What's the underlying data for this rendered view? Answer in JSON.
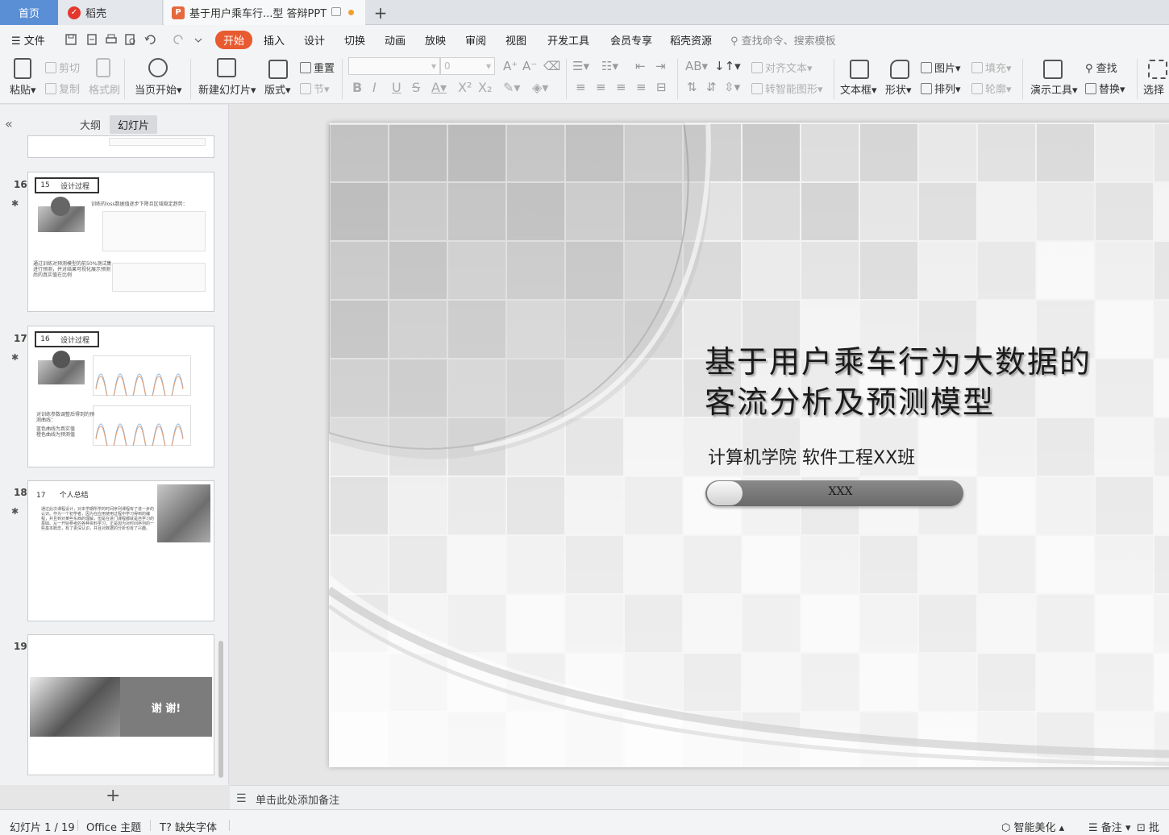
{
  "tabs": {
    "home": "首页",
    "daoke": "稻壳",
    "document": "基于用户乘车行...型 答辩PPT"
  },
  "menu": {
    "file": "文件",
    "items": [
      "开始",
      "插入",
      "设计",
      "切换",
      "动画",
      "放映",
      "审阅",
      "视图",
      "开发工具",
      "会员专享",
      "稻壳资源"
    ],
    "search": "查找命令、搜索模板"
  },
  "ribbon": {
    "paste": "粘贴",
    "cut": "剪切",
    "copy": "复制",
    "format_painter": "格式刷",
    "from_current": "当页开始",
    "new_slide": "新建幻灯片",
    "layout": "版式",
    "reset": "重置",
    "section": "节",
    "font_size": "0",
    "align_text": "对齐文本",
    "smart_graphic": "转智能图形",
    "textbox": "文本框",
    "shape": "形状",
    "picture": "图片",
    "arrange": "排列",
    "fill": "填充",
    "outline": "轮廓",
    "presenter": "演示工具",
    "find": "查找",
    "replace": "替换",
    "select": "选择"
  },
  "left_panel": {
    "outline_tab": "大纲",
    "slides_tab": "幻灯片",
    "slides": [
      {
        "num": "16",
        "header_num": "15",
        "header_title": "设计过程",
        "text1": "训练的loss数据值逐步下降且区域稳定趋势：",
        "text2": "通过训练对预测模型的前50%测试集进行预测，并对结果可视化展示预测后的真实值在比例"
      },
      {
        "num": "17",
        "header_num": "16",
        "header_title": "设计过程",
        "text1": "对训练参数调整后得到的预测曲线：",
        "text2": "蓝色曲线为真实值",
        "text3": "橙色曲线为预测值"
      },
      {
        "num": "18",
        "header_num": "17",
        "header_title": "个人总结",
        "text1": "通过此次课程设计，对本学期所学的时间序列课程有了进一步的认识。作为一个初学者，因为在应用使用过程中学习得到的编程，并且到对某些东西的理解，但是在进门课程都就是自学习的基础。从一开始参考的各种资料学习，正是因为对时间序列的一些基本概念，有了更深认识，并且对数据的分析也有了兴趣。"
      },
      {
        "num": "19",
        "thanks": "谢 谢!"
      }
    ]
  },
  "slide": {
    "title_line1": "基于用户乘车行为大数据的",
    "title_line2": "客流分析及预测模型",
    "subtitle": "计算机学院   软件工程XX班",
    "name": "XXX"
  },
  "notes": {
    "placeholder": "单击此处添加备注"
  },
  "status": {
    "slide_count": "幻灯片 1 / 19",
    "theme": "Office 主题",
    "missing_font": "缺失字体",
    "beautify": "智能美化",
    "notes": "备注",
    "comments": "批注"
  }
}
